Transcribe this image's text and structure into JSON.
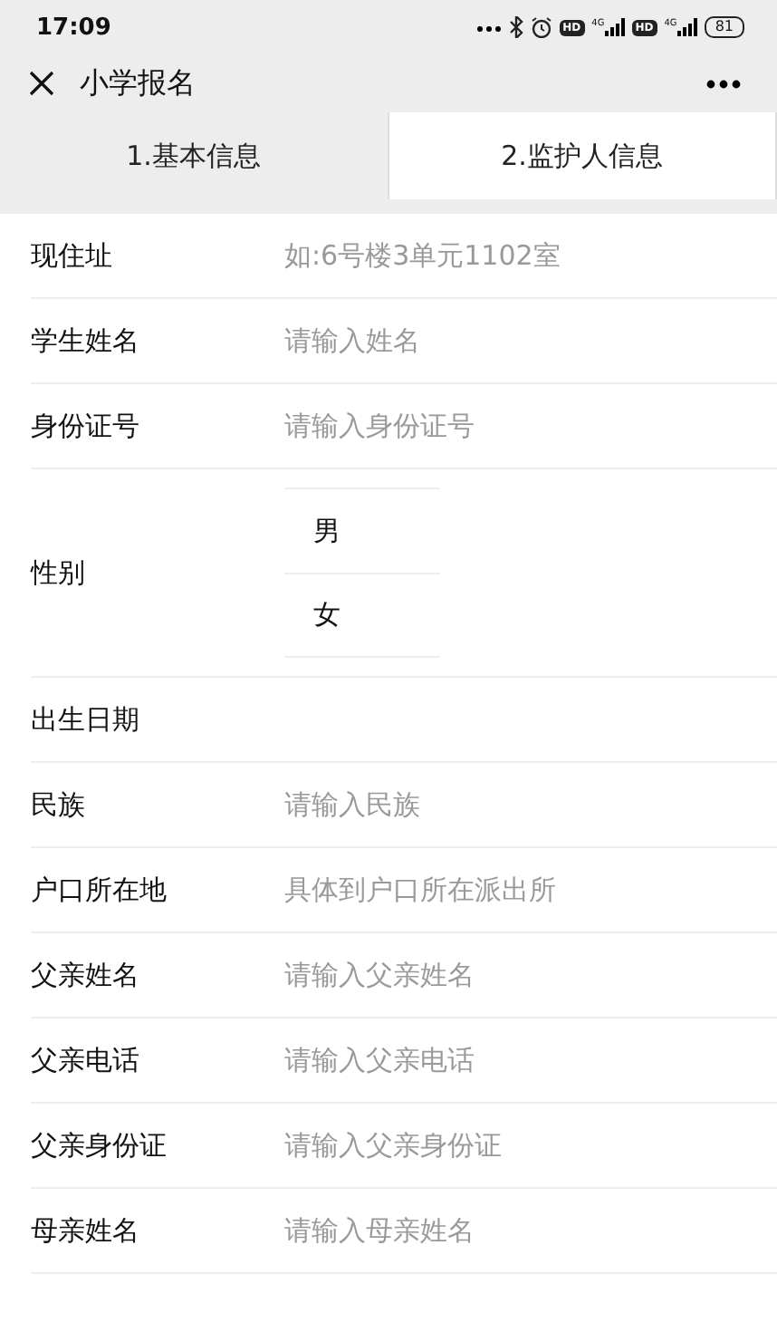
{
  "status_bar": {
    "time": "17:09",
    "hd_labels": [
      "HD",
      "HD"
    ],
    "network_labels": [
      "4G",
      "4G"
    ],
    "battery": "81"
  },
  "nav": {
    "title": "小学报名"
  },
  "tabs": [
    {
      "label": "1.基本信息",
      "selected": false
    },
    {
      "label": "2.监护人信息",
      "selected": true
    }
  ],
  "form": [
    {
      "kind": "input",
      "label": "现住址",
      "placeholder": "如:6号楼3单元1102室"
    },
    {
      "kind": "input",
      "label": "学生姓名",
      "placeholder": "请输入姓名"
    },
    {
      "kind": "input",
      "label": "身份证号",
      "placeholder": "请输入身份证号"
    },
    {
      "kind": "choice",
      "label": "性别",
      "options": [
        "男",
        "女"
      ]
    },
    {
      "kind": "date",
      "label": "出生日期"
    },
    {
      "kind": "input",
      "label": "民族",
      "placeholder": "请输入民族"
    },
    {
      "kind": "input",
      "label": "户口所在地",
      "placeholder": "具体到户口所在派出所"
    },
    {
      "kind": "input",
      "label": "父亲姓名",
      "placeholder": "请输入父亲姓名"
    },
    {
      "kind": "input",
      "label": "父亲电话",
      "placeholder": "请输入父亲电话"
    },
    {
      "kind": "input",
      "label": "父亲身份证",
      "placeholder": "请输入父亲身份证"
    },
    {
      "kind": "input",
      "label": "母亲姓名",
      "placeholder": "请输入母亲姓名"
    }
  ]
}
